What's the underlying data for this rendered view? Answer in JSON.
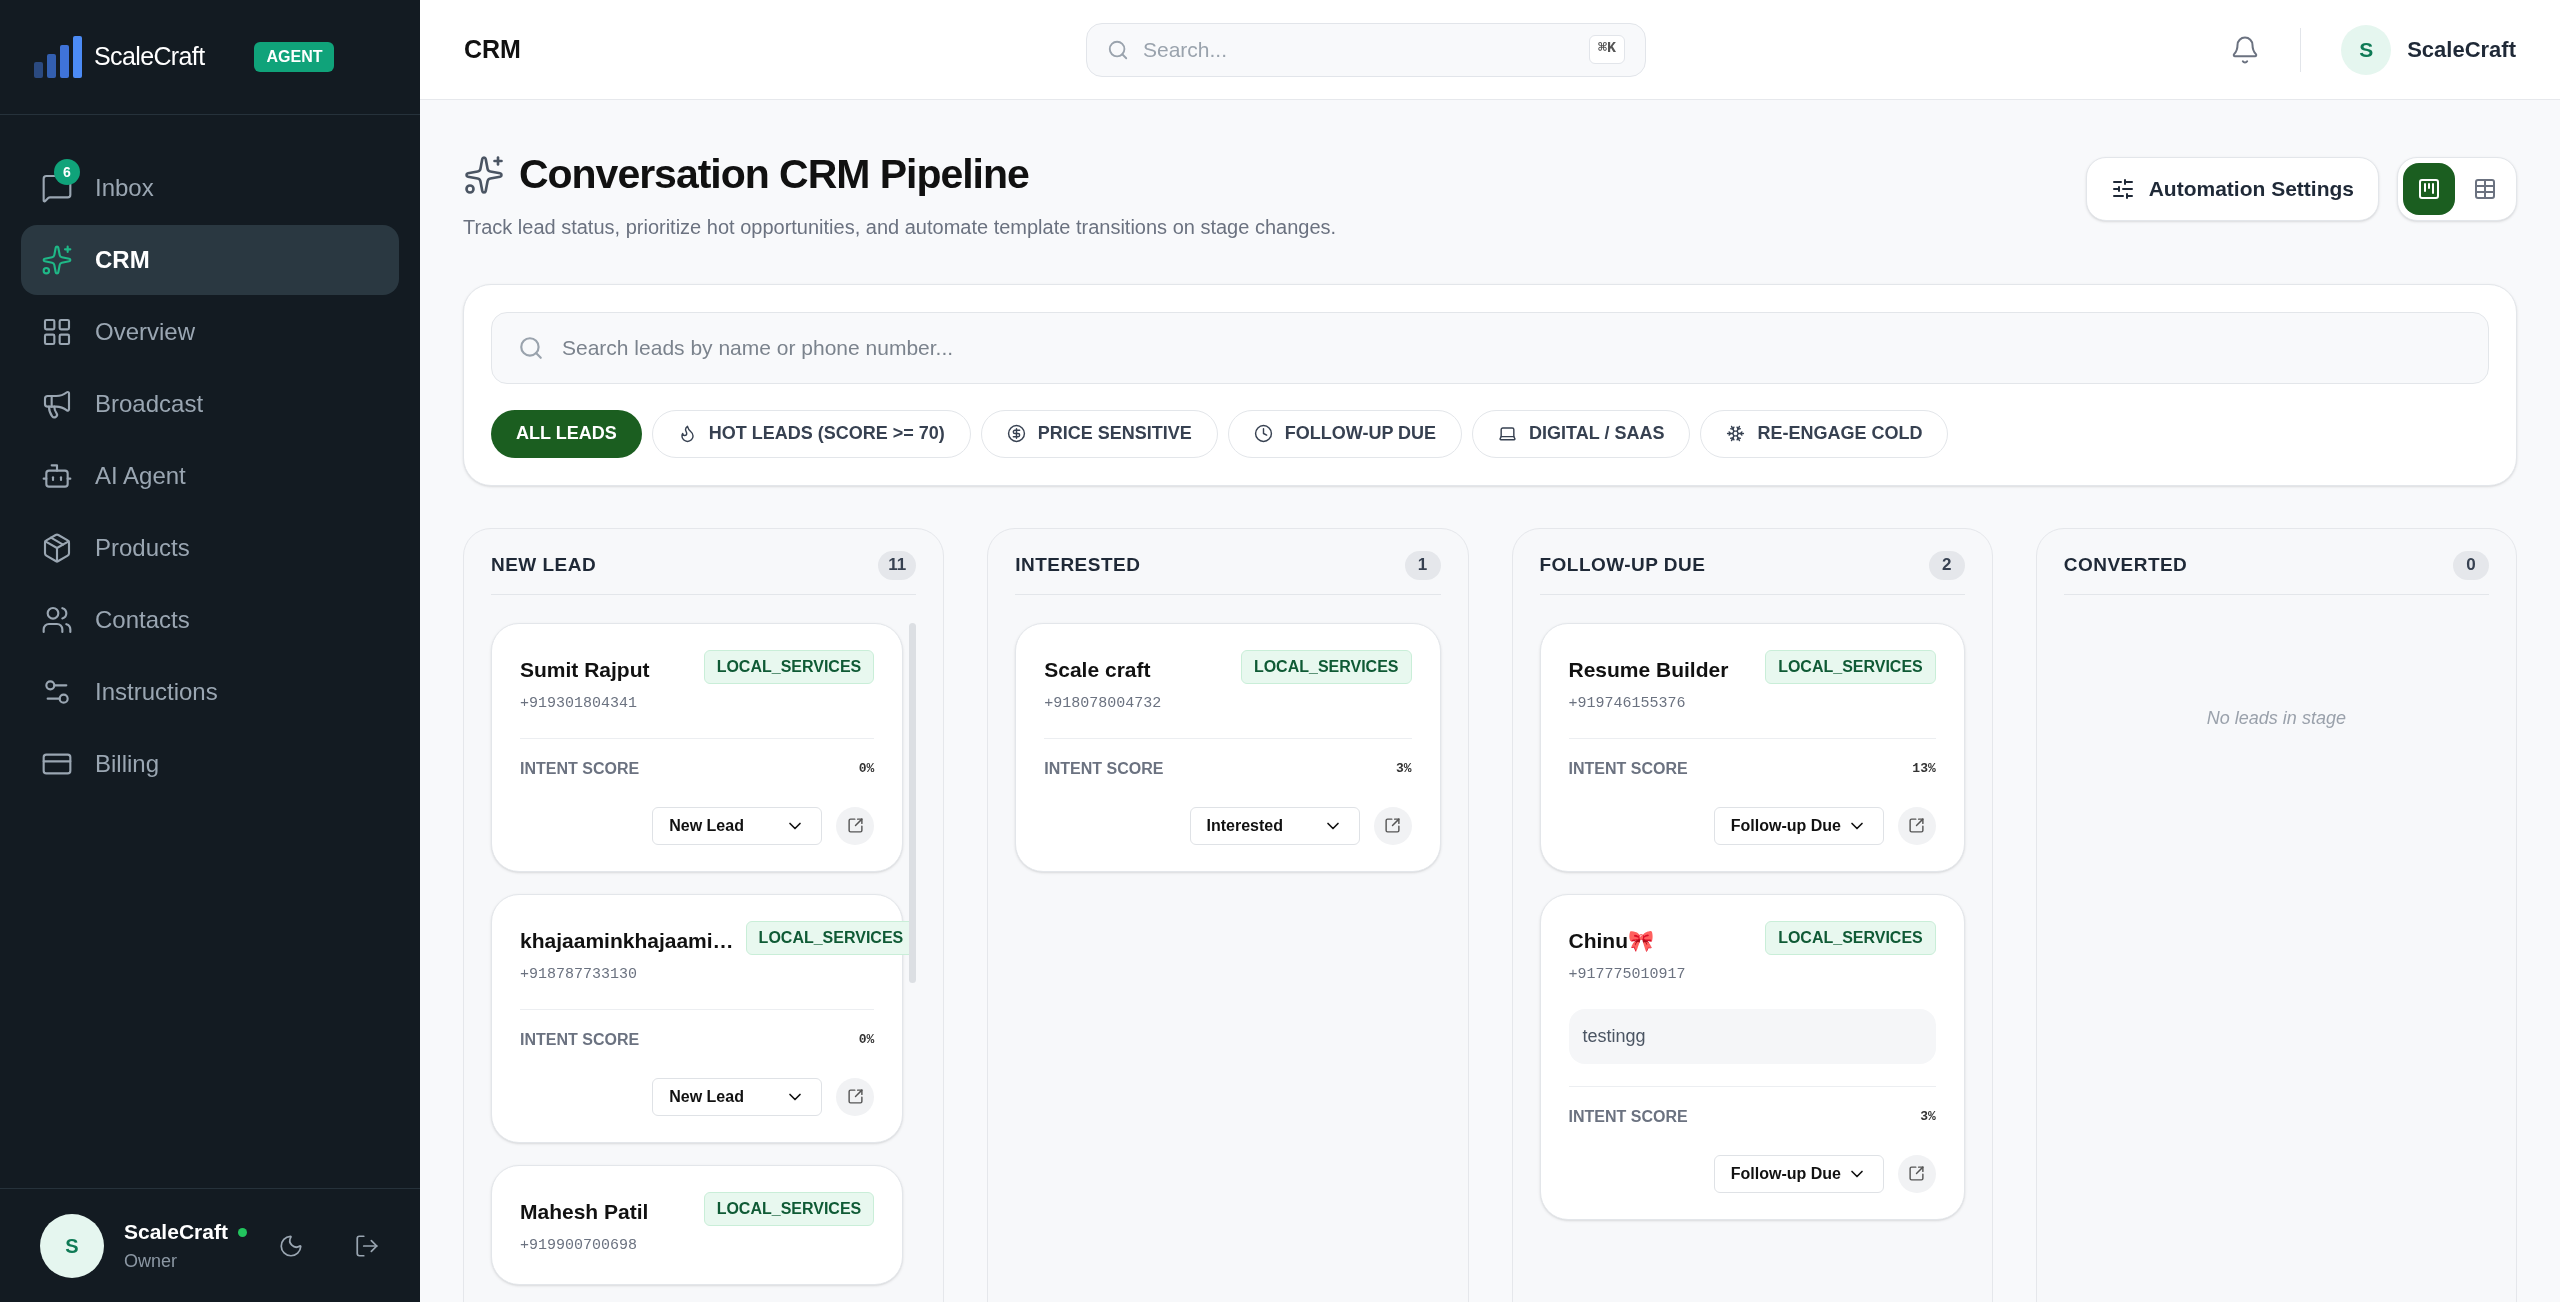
{
  "sidebar": {
    "brand": "ScaleCraft",
    "brand_badge": "AGENT",
    "items": [
      {
        "label": "Inbox",
        "selected": false,
        "badge": "6"
      },
      {
        "label": "CRM",
        "selected": true
      },
      {
        "label": "Overview",
        "selected": false
      },
      {
        "label": "Broadcast",
        "selected": false
      },
      {
        "label": "AI Agent",
        "selected": false
      },
      {
        "label": "Products",
        "selected": false
      },
      {
        "label": "Contacts",
        "selected": false
      },
      {
        "label": "Instructions",
        "selected": false
      },
      {
        "label": "Billing",
        "selected": false
      }
    ],
    "user": {
      "initial": "S",
      "name": "ScaleCraft",
      "role": "Owner",
      "online": true
    }
  },
  "header": {
    "title": "CRM",
    "search": {
      "placeholder": "Search...",
      "shortcut": "⌘K"
    },
    "user": {
      "initial": "S",
      "name": "ScaleCraft"
    }
  },
  "page": {
    "title": "Conversation CRM Pipeline",
    "subtitle": "Track lead status, prioritize hot opportunities, and automate template transitions on stage changes.",
    "automation_button": "Automation Settings",
    "views": [
      {
        "kind": "board",
        "selected": true
      },
      {
        "kind": "table",
        "selected": false
      }
    ]
  },
  "filters": {
    "search": {
      "placeholder": "Search leads by name or phone number..."
    },
    "chips": [
      {
        "label": "ALL LEADS",
        "selected": true
      },
      {
        "label": "HOT LEADS (SCORE >= 70)",
        "selected": false
      },
      {
        "label": "PRICE SENSITIVE",
        "selected": false
      },
      {
        "label": "FOLLOW-UP DUE",
        "selected": false
      },
      {
        "label": "DIGITAL / SAAS",
        "selected": false
      },
      {
        "label": "RE-ENGAGE COLD",
        "selected": false
      }
    ]
  },
  "columns": [
    {
      "title": "NEW LEAD",
      "count": "11",
      "leads": [
        {
          "name": "Sumit Rajput",
          "tag": "LOCAL_SERVICES",
          "phone": "+919301804341",
          "score_label": "INTENT SCORE",
          "score": "0%",
          "stage": "New Lead"
        },
        {
          "name": "khajaaminkhajaami…",
          "tag": "LOCAL_SERVICES",
          "phone": "+918787733130",
          "score_label": "INTENT SCORE",
          "score": "0%",
          "stage": "New Lead"
        },
        {
          "name": "Mahesh Patil",
          "tag": "LOCAL_SERVICES",
          "phone": "+919900700698"
        }
      ]
    },
    {
      "title": "INTERESTED",
      "count": "1",
      "leads": [
        {
          "name": "Scale craft",
          "tag": "LOCAL_SERVICES",
          "phone": "+918078004732",
          "score_label": "INTENT SCORE",
          "score": "3%",
          "stage": "Interested"
        }
      ]
    },
    {
      "title": "FOLLOW-UP DUE",
      "count": "2",
      "leads": [
        {
          "name": "Resume Builder",
          "tag": "LOCAL_SERVICES",
          "phone": "+919746155376",
          "score_label": "INTENT SCORE",
          "score": "13%",
          "stage": "Follow-up Due"
        },
        {
          "name": "Chinu🎀",
          "tag": "LOCAL_SERVICES",
          "phone": "+917775010917",
          "note": "testingg",
          "score_label": "INTENT SCORE",
          "score": "3%",
          "stage": "Follow-up Due"
        }
      ]
    },
    {
      "title": "CONVERTED",
      "count": "0",
      "empty_text": "No leads in stage"
    }
  ]
}
